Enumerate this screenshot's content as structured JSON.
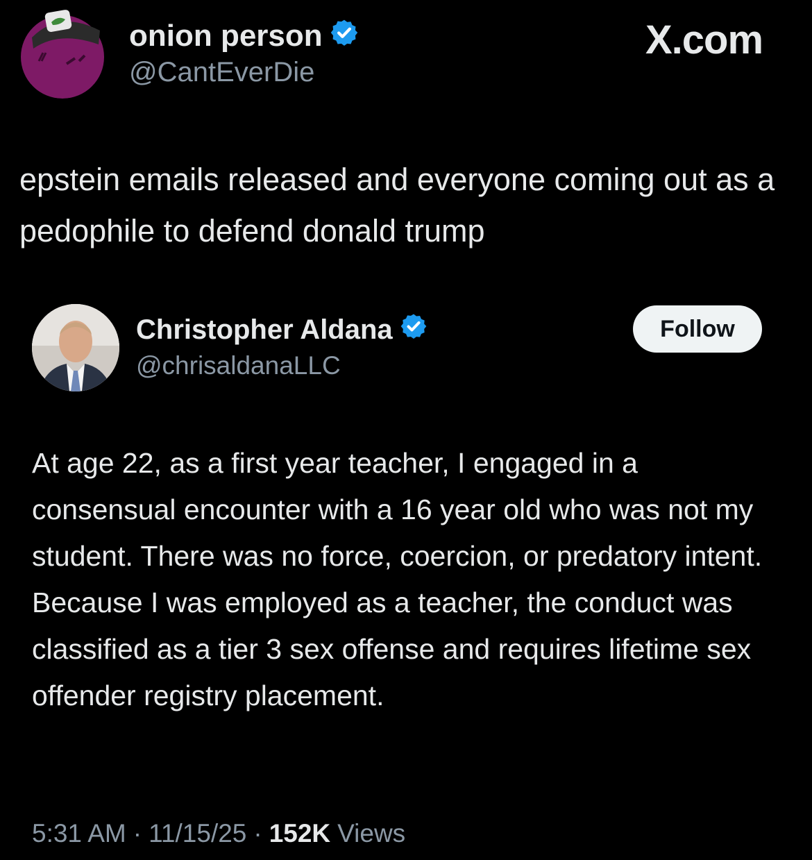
{
  "outer_tweet": {
    "display_name": "onion person",
    "handle": "@CantEverDie",
    "text": "epstein emails released and everyone coming out as a pedophile to defend donald trump",
    "verified_icon": "verified-badge-icon",
    "avatar_icon": "onion-avatar-icon"
  },
  "watermark": {
    "label": "X.com"
  },
  "quoted_tweet": {
    "display_name": "Christopher Aldana",
    "handle": "@chrisaldanaLLC",
    "follow_label": "Follow",
    "text": "At age 22, as a first year teacher, I engaged in a consensual encounter with a 16 year old who was not my student. There was no force, coercion, or predatory intent. Because I was employed as a teacher, the conduct was classified as a tier 3 sex offense and requires lifetime sex offender registry placement.",
    "time": "5:31 AM",
    "date": "11/15/25",
    "views_count": "152K",
    "views_label": "Views",
    "separator": "·",
    "verified_icon": "verified-badge-icon",
    "avatar_icon": "profile-photo-icon"
  },
  "colors": {
    "background": "#000000",
    "text": "#e7e9ea",
    "muted": "#8b98a5",
    "verified": "#1d9bf0",
    "follow_bg": "#eff3f4"
  }
}
